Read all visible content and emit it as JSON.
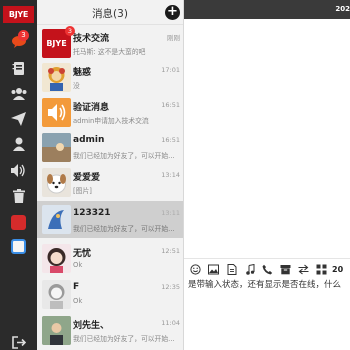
{
  "sidebar": {
    "logo_text": "BJYE",
    "chat_badge": "3",
    "colors": {
      "background": "#2b2b2b",
      "logo": "#c4121b",
      "badge": "#e33333"
    }
  },
  "list": {
    "title": "消息(3)",
    "add_label": "+",
    "conversations": [
      {
        "name": "技术交流",
        "time": "刚刚",
        "message": "托马斯: 这不是大蛮的吧",
        "badge": "3",
        "avatar_text": "BJYE"
      },
      {
        "name": "魅惑",
        "time": "17:01",
        "message": "没"
      },
      {
        "name": "验证消息",
        "time": "16:51",
        "message": "admin申请加入技术交流"
      },
      {
        "name": "admin",
        "time": "16:51",
        "message": "我们已经加为好友了，可以开始..."
      },
      {
        "name": "爱爱爱",
        "time": "13:14",
        "message": "[图片]"
      },
      {
        "name": "123321",
        "time": "13:11",
        "message": "我们已经加为好友了，可以开始..."
      },
      {
        "name": "无忧",
        "time": "12:51",
        "message": "Ok"
      },
      {
        "name": "F",
        "time": "12:35",
        "message": "Ok"
      },
      {
        "name": "刘先生、",
        "time": "11:04",
        "message": "我们已经加为好友了，可以开始..."
      }
    ]
  },
  "chat": {
    "date_text": "202",
    "status_text": "是带输入状态，还有显示是否在线，什么",
    "toolbar_text": "20"
  }
}
